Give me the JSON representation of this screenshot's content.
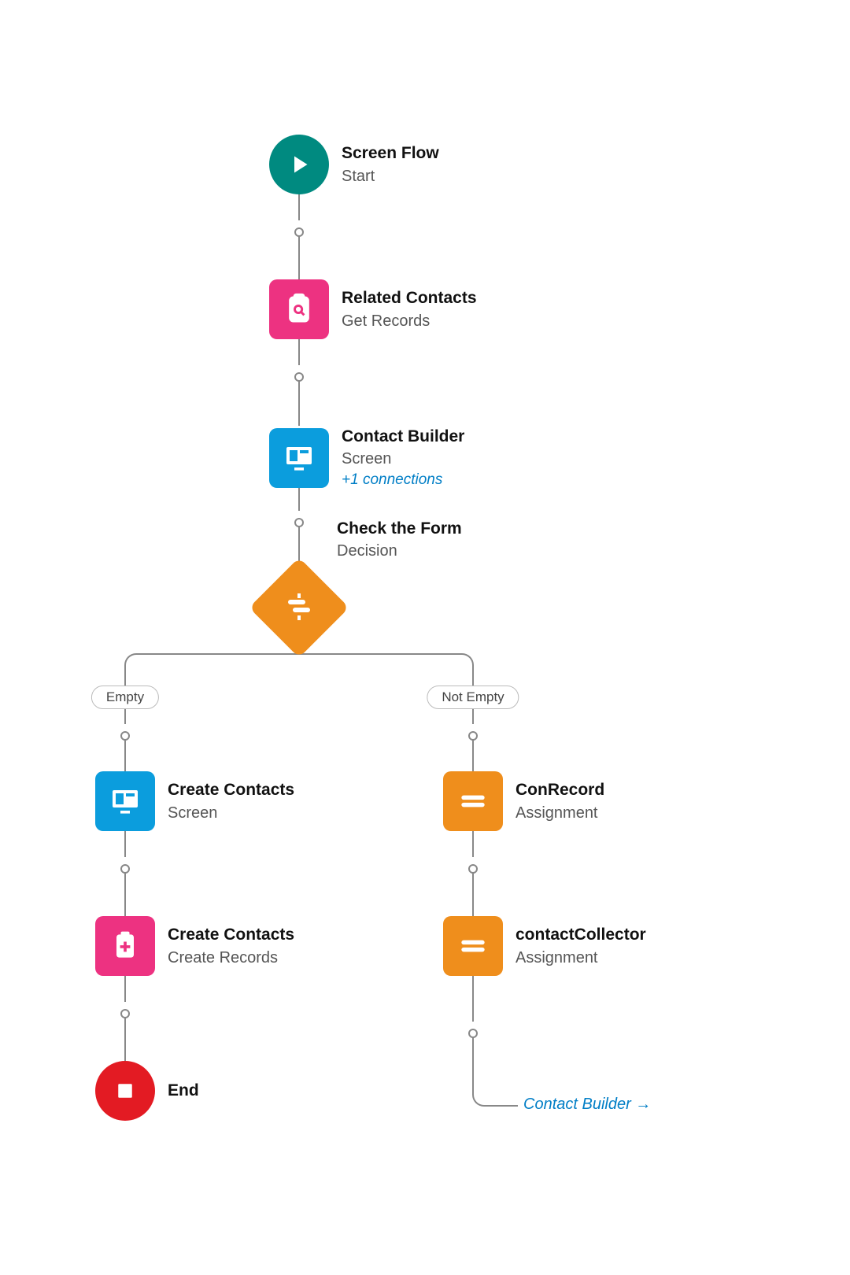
{
  "nodes": {
    "start": {
      "title": "Screen Flow",
      "subtitle": "Start"
    },
    "getRecords": {
      "title": "Related Contacts",
      "subtitle": "Get Records"
    },
    "screen1": {
      "title": "Contact Builder",
      "subtitle": "Screen",
      "extra": "+1 connections"
    },
    "decision": {
      "title": "Check the Form",
      "subtitle": "Decision"
    },
    "branchLeft": {
      "label": "Empty"
    },
    "branchRight": {
      "label": "Not Empty"
    },
    "screen2": {
      "title": "Create Contacts",
      "subtitle": "Screen"
    },
    "createRecords": {
      "title": "Create Contacts",
      "subtitle": "Create Records"
    },
    "end": {
      "title": "End"
    },
    "assign1": {
      "title": "ConRecord",
      "subtitle": "Assignment"
    },
    "assign2": {
      "title": "contactCollector",
      "subtitle": "Assignment"
    },
    "loopback": {
      "label": "Contact Builder →"
    }
  },
  "colors": {
    "start": "#008a80",
    "data": "#ed3281",
    "screen": "#0b9ddd",
    "decision": "#ef8e1c",
    "assignment": "#ef8e1c",
    "end": "#e31b23"
  }
}
